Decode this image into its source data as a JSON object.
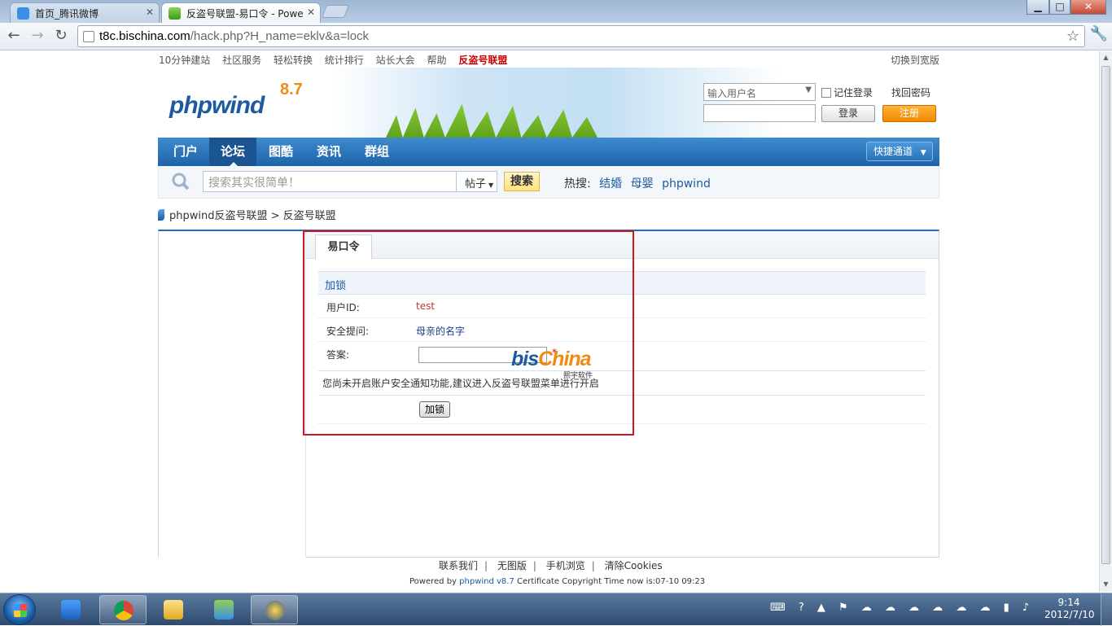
{
  "browser": {
    "tabs": [
      {
        "label": "首页_腾讯微博",
        "active": false
      },
      {
        "label": "反盗号联盟-易口令 - Powe",
        "active": true
      }
    ],
    "url_host": "t8c.bischina.com",
    "url_path": "/hack.php?H_name=eklv&a=lock",
    "window_controls": {
      "min": "▁",
      "max": "□",
      "close": "✕"
    }
  },
  "site": {
    "topbar_links": [
      "10分钟建站",
      "社区服务",
      "轻松转换",
      "统计排行",
      "站长大会",
      "帮助"
    ],
    "topbar_highlight": "反盗号联盟",
    "switch_wide": "切换到宽版",
    "logo_text": "phpwind",
    "logo_version": "8.7",
    "login": {
      "username_placeholder": "输入用户名",
      "remember": "记住登录",
      "find_password": "找回密码",
      "login_btn": "登录",
      "register_btn": "注册"
    },
    "nav": [
      "门户",
      "论坛",
      "图酷",
      "资讯",
      "群组"
    ],
    "nav_current": "论坛",
    "quick_channel": "快捷通道",
    "search": {
      "placeholder": "搜索其实很简单！",
      "type": "帖子",
      "button": "搜索",
      "hot_label": "热搜:",
      "hot_terms": [
        "结婚",
        "母婴",
        "phpwind"
      ]
    },
    "breadcrumb": [
      "phpwind反盗号联盟",
      "反盗号联盟"
    ]
  },
  "form": {
    "tab": "易口令",
    "section": "加锁",
    "user_id_label": "用户ID:",
    "user_id_value": "test",
    "question_label": "安全提问:",
    "question_value": "母亲的名字",
    "answer_label": "答案:",
    "required_mark": "*",
    "notice": "您尚未开启账户安全通知功能,建议进入反盗号联盟菜单进行开启",
    "submit": "加锁"
  },
  "watermark": {
    "brand_a": "bis",
    "brand_b": "China",
    "sub": "熙宇软件"
  },
  "footer": {
    "links": [
      "联系我们",
      "无图版",
      "手机浏览",
      "清除Cookies"
    ],
    "powered_prefix": "Powered by",
    "powered_name": "phpwind v8.7",
    "powered_suffix": "Certificate Copyright Time now is:07-10 09:23"
  },
  "taskbar": {
    "time": "9:14",
    "date": "2012/7/10"
  },
  "colors": {
    "nav_blue": "#1f63a8",
    "highlight_red": "#cc0000",
    "register_orange": "#f08a00",
    "annotation_red": "#d2161e"
  }
}
